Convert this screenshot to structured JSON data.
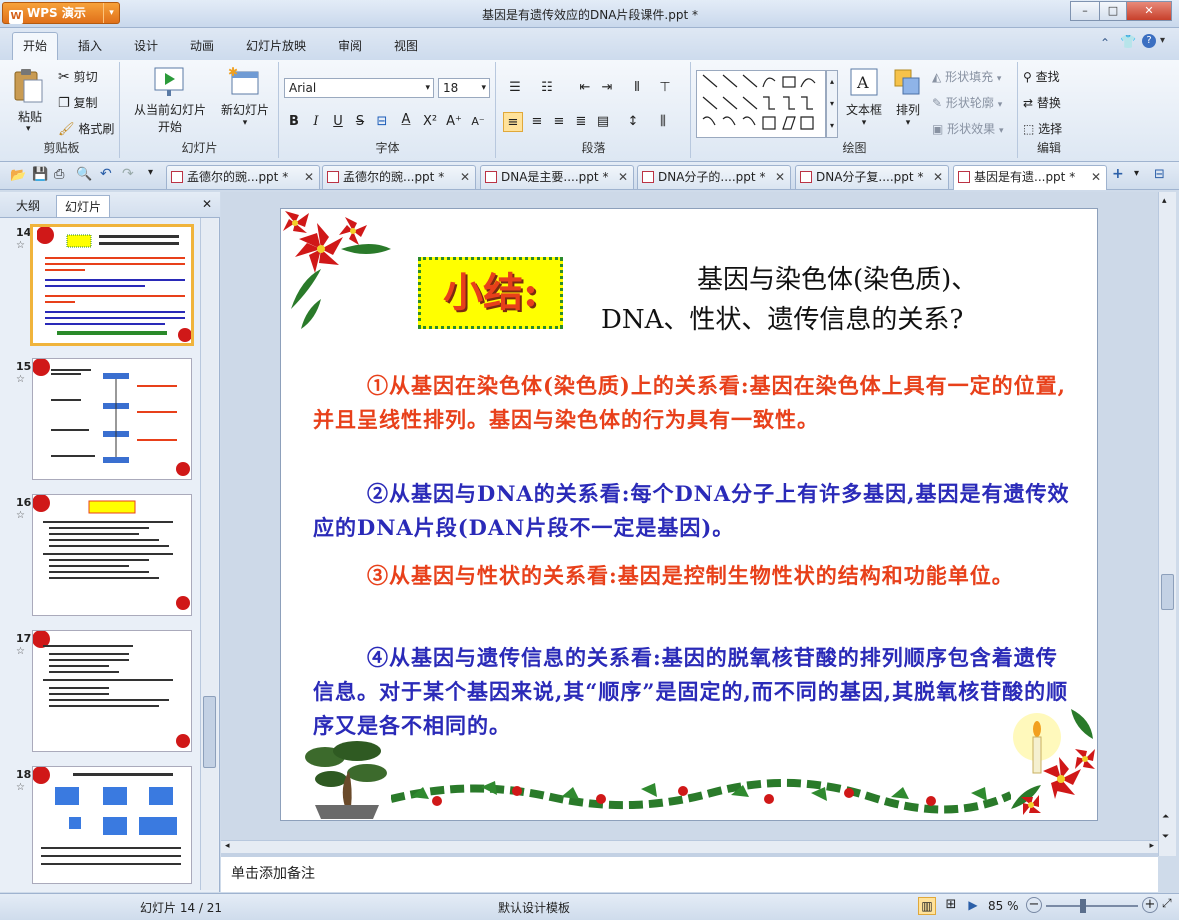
{
  "app": {
    "name": "WPS 演示",
    "title": "基因是有遗传效应的DNA片段课件.ppt *"
  },
  "menu": [
    "开始",
    "插入",
    "设计",
    "动画",
    "幻灯片放映",
    "审阅",
    "视图"
  ],
  "ribbon": {
    "clipboard": {
      "paste": "粘贴",
      "cut": "剪切",
      "copy": "复制",
      "format_painter": "格式刷",
      "label": "剪贴板"
    },
    "slides": {
      "from_current": "从当前幻灯片",
      "start": "开始",
      "new_slide": "新幻灯片",
      "label": "幻灯片"
    },
    "font": {
      "name": "Arial",
      "size": "18",
      "label": "字体"
    },
    "paragraph": {
      "label": "段落"
    },
    "drawing": {
      "textbox": "文本框",
      "arrange": "排列",
      "fill": "形状填充",
      "outline": "形状轮廓",
      "effect": "形状效果",
      "label": "绘图"
    },
    "editing": {
      "find": "查找",
      "replace": "替换",
      "select": "选择",
      "label": "编辑"
    }
  },
  "doc_tabs": [
    {
      "label": "孟德尔的豌...ppt *",
      "active": false
    },
    {
      "label": "孟德尔的豌...ppt *",
      "active": false
    },
    {
      "label": "DNA是主要....ppt *",
      "active": false
    },
    {
      "label": "DNA分子的....ppt *",
      "active": false
    },
    {
      "label": "DNA分子复....ppt *",
      "active": false
    },
    {
      "label": "基因是有遗...ppt *",
      "active": true
    }
  ],
  "left_pane": {
    "tabs": [
      "大纲",
      "幻灯片"
    ],
    "slides": [
      "14",
      "15",
      "16",
      "17",
      "18"
    ]
  },
  "slide": {
    "tag": "小结:",
    "title_line1": "基因与染色体(染色质)、",
    "title_line2": "DNA、性状、遗传信息的关系?",
    "p1": "①从基因在染色体(染色质)上的关系看:基因在染色体上具有一定的位置,并且呈线性排列。基因与染色体的行为具有一致性。",
    "p2": "②从基因与DNA的关系看:每个DNA分子上有许多基因,基因是有遗传效应的DNA片段(DAN片段不一定是基因)。",
    "p3": "③从基因与性状的关系看:基因是控制生物性状的结构和功能单位。",
    "p4": "④从基因与遗传信息的关系看:基因的脱氧核苷酸的排列顺序包含着遗传信息。对于某个基因来说,其“顺序”是固定的,而不同的基因,其脱氧核苷酸的顺序又是各不相同的。"
  },
  "notes_placeholder": "单击添加备注",
  "status": {
    "slide_counter": "幻灯片 14 / 21",
    "template": "默认设计模板",
    "zoom": "85 %"
  },
  "colors": {
    "red_text": "#e8401a",
    "blue_text": "#2a2ab8",
    "tag_bg": "#ffff00"
  }
}
